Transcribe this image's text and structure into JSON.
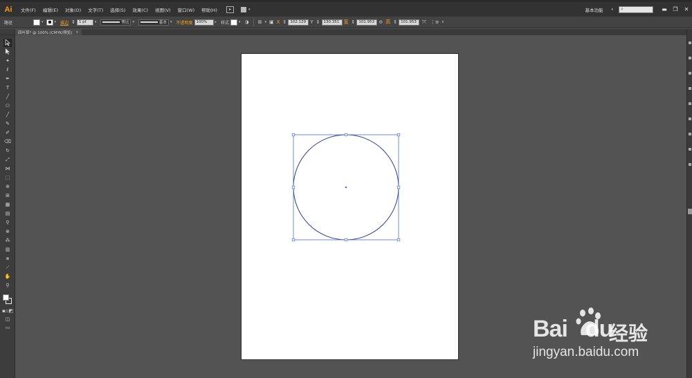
{
  "app": {
    "logo": "Ai"
  },
  "menu": [
    "文件(F)",
    "编辑(E)",
    "对象(O)",
    "文字(T)",
    "选择(S)",
    "效果(C)",
    "视图(V)",
    "窗口(W)",
    "帮助(H)"
  ],
  "menubar_right": {
    "workspace": "基本功能",
    "window_buttons": [
      "▬",
      "❐",
      "✕"
    ]
  },
  "controlbar": {
    "object_type": "路径",
    "stroke_label": "描边",
    "stroke_weight": "1 pt",
    "profile_label": "等比",
    "brush_label": "基本",
    "opacity_label": "不透明度",
    "opacity_value": "100%",
    "style_label": "样式",
    "x_label": "X",
    "x_value": "102.129",
    "y_label": "Y",
    "y_value": "130.351",
    "w_label": "宽",
    "w_value": "101.953",
    "h_label": "高",
    "h_value": "101.953"
  },
  "document_tab": {
    "title": "四叶草* @ 100% (CMYK/预览)",
    "close": "×"
  },
  "canvas": {
    "selection_color": "#4a6fd8",
    "circle_stroke": "#2e3f8f"
  },
  "watermark": {
    "brand": "Bai",
    "brand2": "du",
    "product": "经验",
    "url": "jingyan.baidu.com"
  }
}
